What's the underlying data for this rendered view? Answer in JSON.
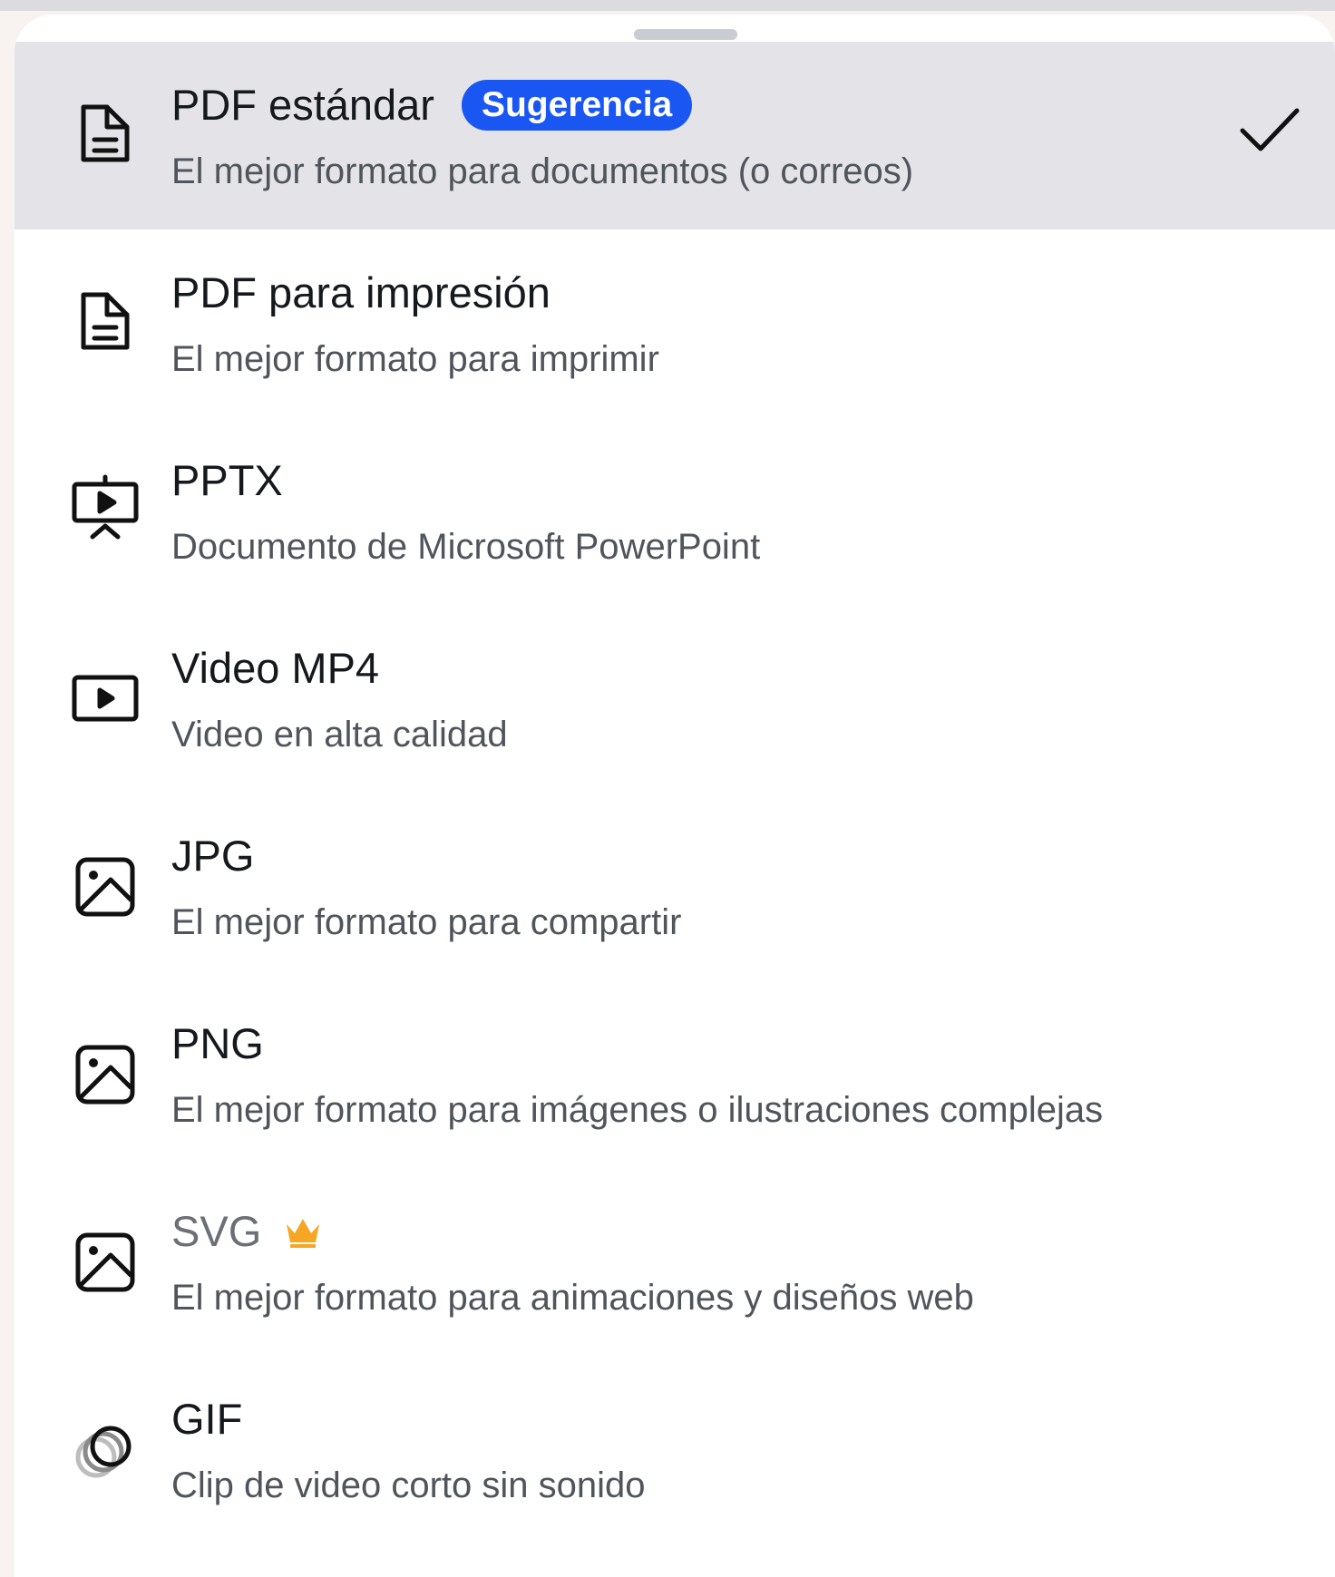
{
  "sheet": {
    "items": [
      {
        "id": "pdf-standard",
        "title": "PDF estándar",
        "badge": "Sugerencia",
        "subtitle": "El mejor formato para documentos (o correos)",
        "icon": "document-icon",
        "selected": true
      },
      {
        "id": "pdf-print",
        "title": "PDF para impresión",
        "subtitle": "El mejor formato para imprimir",
        "icon": "document-icon"
      },
      {
        "id": "pptx",
        "title": "PPTX",
        "subtitle": "Documento de Microsoft PowerPoint",
        "icon": "presentation-icon"
      },
      {
        "id": "mp4",
        "title": "Video MP4",
        "subtitle": "Video en alta calidad",
        "icon": "video-icon"
      },
      {
        "id": "jpg",
        "title": "JPG",
        "subtitle": "El mejor formato para compartir",
        "icon": "image-icon"
      },
      {
        "id": "png",
        "title": "PNG",
        "subtitle": "El mejor formato para imágenes o ilustraciones complejas",
        "icon": "image-icon"
      },
      {
        "id": "svg",
        "title": "SVG",
        "subtitle": "El mejor formato para animaciones y diseños web",
        "icon": "image-icon",
        "premium_icon": "crown-icon"
      },
      {
        "id": "gif",
        "title": "GIF",
        "subtitle": "Clip de video corto sin sonido",
        "icon": "gif-icon"
      }
    ]
  },
  "colors": {
    "badge": "#1a56f2",
    "selected_bg": "#e4e4e8",
    "crown": "#f5a623"
  }
}
